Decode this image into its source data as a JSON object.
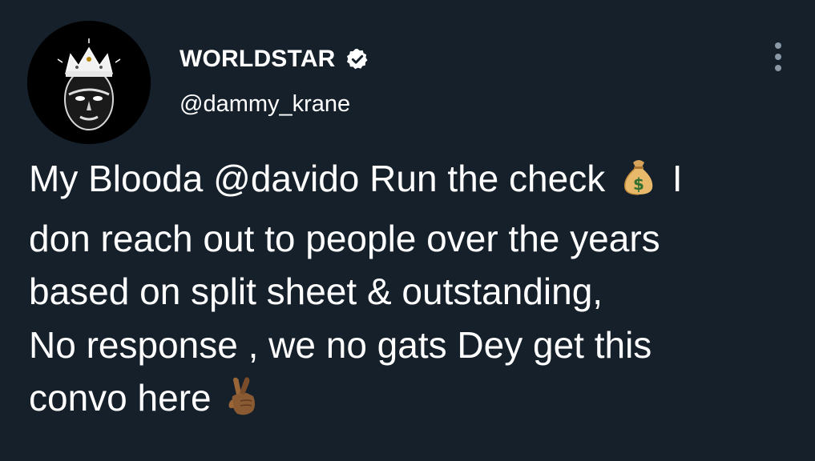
{
  "tweet": {
    "author": {
      "display_name": "WORLDSTAR",
      "handle": "@dammy_krane",
      "verified": true,
      "avatar_icon": "avatar-king-crown-icon"
    },
    "menu_icon": "more-options-icon",
    "text": {
      "line1_a": "My Blooda ",
      "mention": "@davido",
      "line1_b": " Run the check ",
      "line1_c": " I",
      "line2": "don reach out to people over the years",
      "line3": "based on split sheet & outstanding,",
      "line4": "No response , we no gats Dey get this",
      "line5_a": "convo here ",
      "emoji_1": "money-bag-emoji",
      "emoji_2": "crossed-fingers-emoji"
    }
  },
  "colors": {
    "background": "#15202b",
    "text": "#ffffff",
    "muted": "#8b98a5",
    "verified_badge": "#ffffff"
  }
}
